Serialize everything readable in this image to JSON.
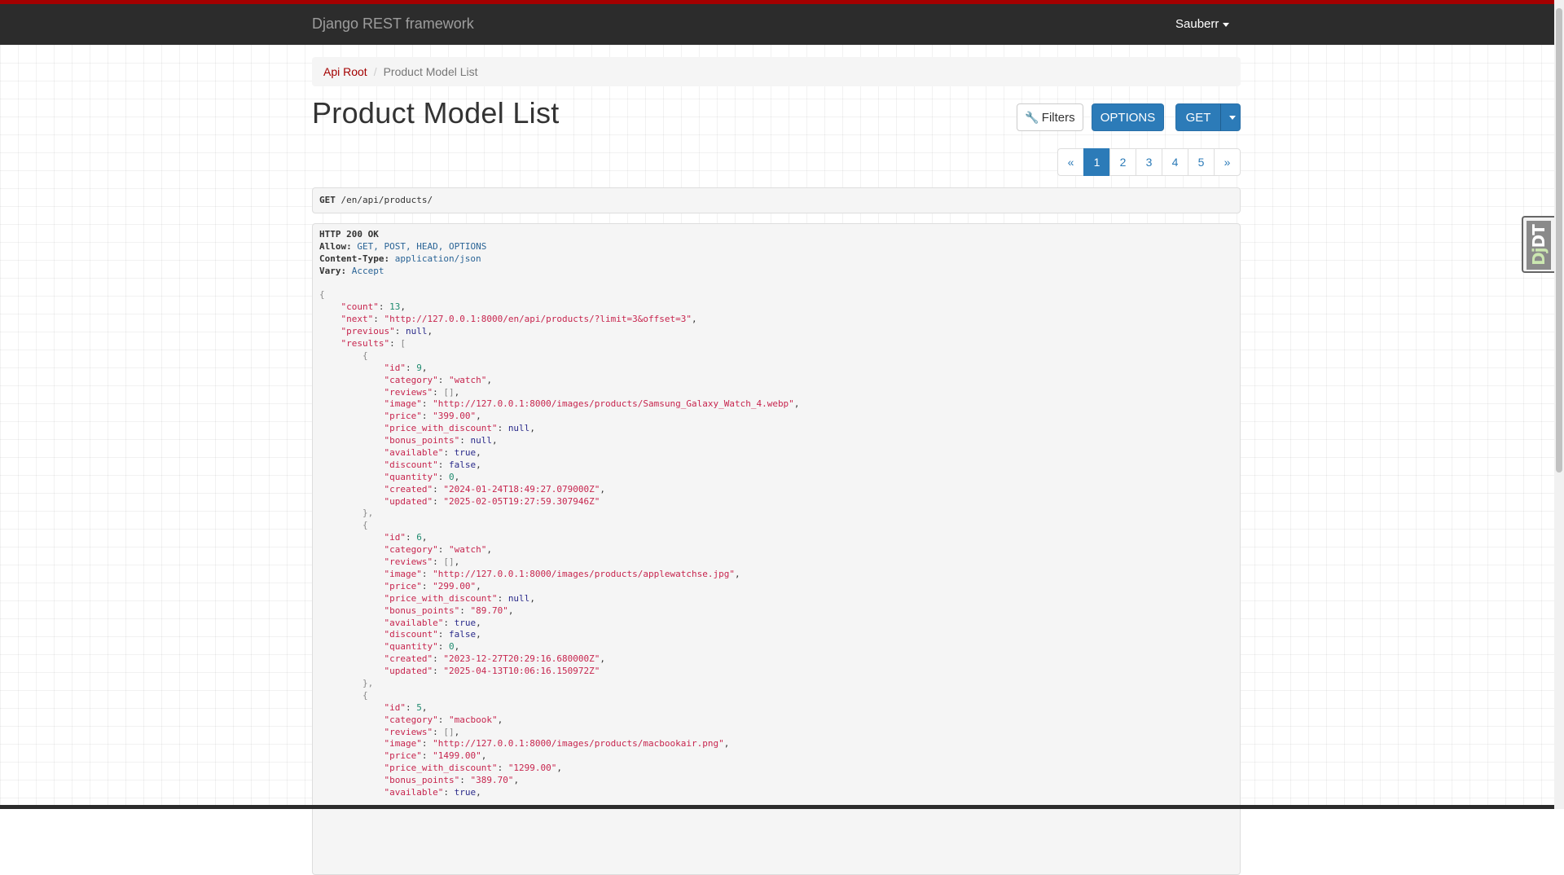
{
  "navbar": {
    "brand": "Django REST framework",
    "user": "Sauberr"
  },
  "breadcrumb": {
    "root": "Api Root",
    "separator": "/",
    "current": "Product Model List"
  },
  "page_title": "Product Model List",
  "buttons": {
    "filters": "Filters",
    "options": "OPTIONS",
    "get": "GET"
  },
  "pagination": {
    "prev": "«",
    "pages": [
      "1",
      "2",
      "3",
      "4",
      "5"
    ],
    "next": "»",
    "active": "1"
  },
  "request": {
    "method": "GET",
    "path": "/en/api/products/"
  },
  "response": {
    "status": "HTTP 200 OK",
    "headers": [
      {
        "key": "Allow:",
        "value": "GET, POST, HEAD, OPTIONS"
      },
      {
        "key": "Content-Type:",
        "value": "application/json"
      },
      {
        "key": "Vary:",
        "value": "Accept"
      }
    ],
    "body": {
      "count": "13",
      "next": "\"http://127.0.0.1:8000/en/api/products/?limit=3&offset=3\"",
      "previous": "null",
      "results": [
        {
          "id": "9",
          "category": "\"watch\"",
          "reviews": "[]",
          "image": "\"http://127.0.0.1:8000/images/products/Samsung_Galaxy_Watch_4.webp\"",
          "price": "\"399.00\"",
          "price_with_discount": "null",
          "bonus_points": "null",
          "available": "true",
          "discount": "false",
          "quantity": "0",
          "created": "\"2024-01-24T18:49:27.079000Z\"",
          "updated": "\"2025-02-05T19:27:59.307946Z\""
        },
        {
          "id": "6",
          "category": "\"watch\"",
          "reviews": "[]",
          "image": "\"http://127.0.0.1:8000/images/products/applewatchse.jpg\"",
          "price": "\"299.00\"",
          "price_with_discount": "null",
          "bonus_points": "\"89.70\"",
          "available": "true",
          "discount": "false",
          "quantity": "0",
          "created": "\"2023-12-27T20:29:16.680000Z\"",
          "updated": "\"2025-04-13T10:06:16.150972Z\""
        },
        {
          "id": "5",
          "category": "\"macbook\"",
          "reviews": "[]",
          "image": "\"http://127.0.0.1:8000/images/products/macbookair.png\"",
          "price": "\"1499.00\"",
          "price_with_discount": "\"1299.00\"",
          "bonus_points": "\"389.70\"",
          "available": "true"
        }
      ]
    }
  },
  "debug_toolbar": {
    "label_dj": "Dj",
    "label_dt": "DT"
  },
  "colors": {
    "accent": "#a30000",
    "primary": "#2c7bb8",
    "navbar": "#2c2c2c"
  }
}
